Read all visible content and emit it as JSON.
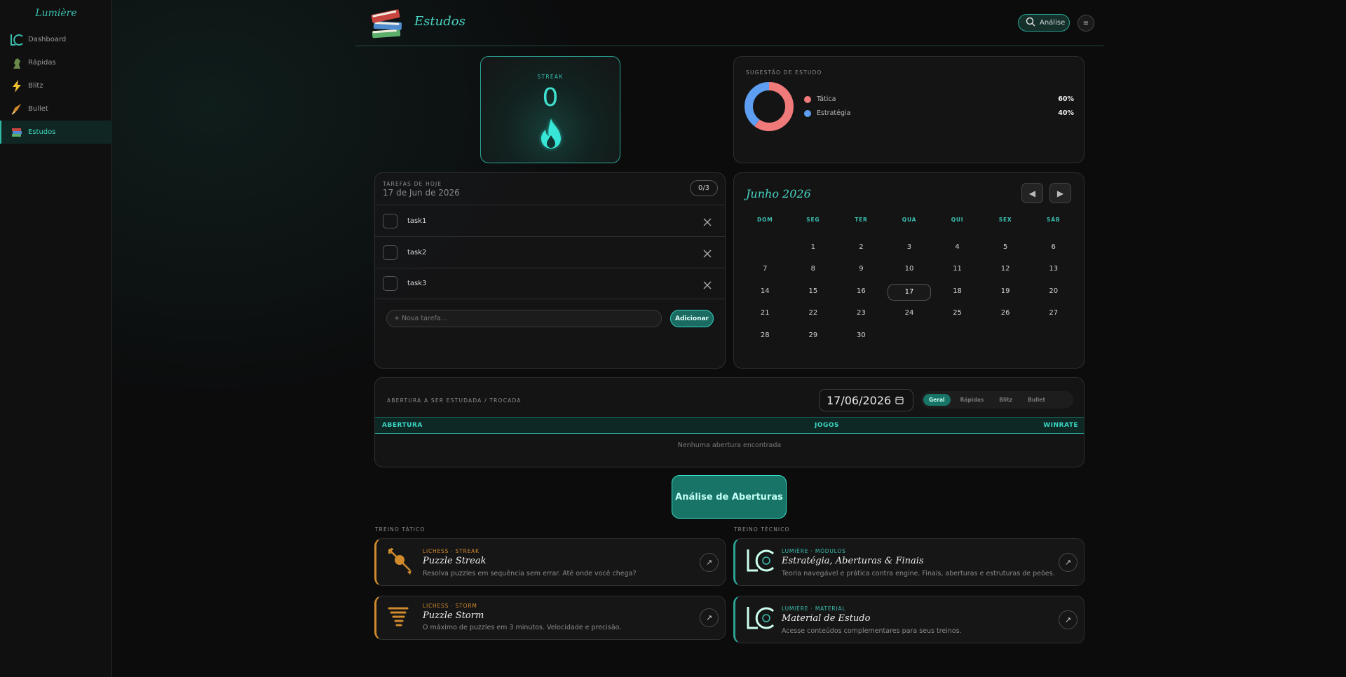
{
  "brand": "Lumière",
  "sidebar": {
    "items": [
      {
        "label": "Dashboard",
        "icon": "lc-logo-icon"
      },
      {
        "label": "Rápidas",
        "icon": "rapid-icon"
      },
      {
        "label": "Blitz",
        "icon": "lightning-icon"
      },
      {
        "label": "Bullet",
        "icon": "bullet-icon"
      },
      {
        "label": "Estudos",
        "icon": "books-icon",
        "active": true
      }
    ]
  },
  "header": {
    "title": "Estudos",
    "search_label": "Análise",
    "menu_glyph": "≡"
  },
  "streak": {
    "label": "STREAK",
    "value": "0"
  },
  "suggestion": {
    "label": "SUGESTÃO DE ESTUDO",
    "items": [
      {
        "name": "Tática",
        "percent": "60%",
        "value": 60,
        "color": "#f07a7a"
      },
      {
        "name": "Estratégia",
        "percent": "40%",
        "value": 40,
        "color": "#5d9df2"
      }
    ]
  },
  "tasks": {
    "label": "TAREFAS DE HOJE",
    "date": "17 de Jun de 2026",
    "count": "0/3",
    "items": [
      {
        "name": "task1"
      },
      {
        "name": "task2"
      },
      {
        "name": "task3"
      }
    ],
    "new_placeholder": "+ Nova tarefa...",
    "add_label": "Adicionar"
  },
  "calendar": {
    "month": "Junho 2026",
    "prev": "◀",
    "next": "▶",
    "weekdays": [
      "DOM",
      "SEG",
      "TER",
      "QUA",
      "QUI",
      "SEX",
      "SÁB"
    ],
    "first_weekday": 1,
    "days": 30,
    "today": 17
  },
  "openings": {
    "label": "ABERTURA A SER ESTUDADA / TROCADA",
    "date": "17/06/2026",
    "filters": [
      "Geral",
      "Rápidas",
      "Blitz",
      "Bullet"
    ],
    "active_filter": "Geral",
    "columns": [
      "ABERTURA",
      "JOGOS",
      "WINRATE"
    ],
    "empty": "Nenhuma abertura encontrada"
  },
  "analysis_button": "Análise de Aberturas",
  "tactical": {
    "label": "TREINO TÁTICO",
    "cards": [
      {
        "kicker": "LICHESS · STREAK",
        "title": "Puzzle Streak",
        "desc": "Resolva puzzles em sequência sem errar. Até onde você chega?"
      },
      {
        "kicker": "LICHESS · STORM",
        "title": "Puzzle Storm",
        "desc": "O máximo de puzzles em 3 minutos. Velocidade e precisão."
      }
    ]
  },
  "technical": {
    "label": "TREINO TÉCNICO",
    "cards": [
      {
        "kicker": "LUMIÈRE · MÓDULOS",
        "title": "Estratégia, Aberturas & Finais",
        "desc": "Teoria navegável e prática contra engine. Finais, aberturas e estruturas de peões."
      },
      {
        "kicker": "LUMIÈRE · MATERIAL",
        "title": "Material de Estudo",
        "desc": "Acesse conteúdos complementares para seus treinos."
      }
    ]
  },
  "colors": {
    "accent": "#3bbfae",
    "orange": "#d08a2c"
  }
}
